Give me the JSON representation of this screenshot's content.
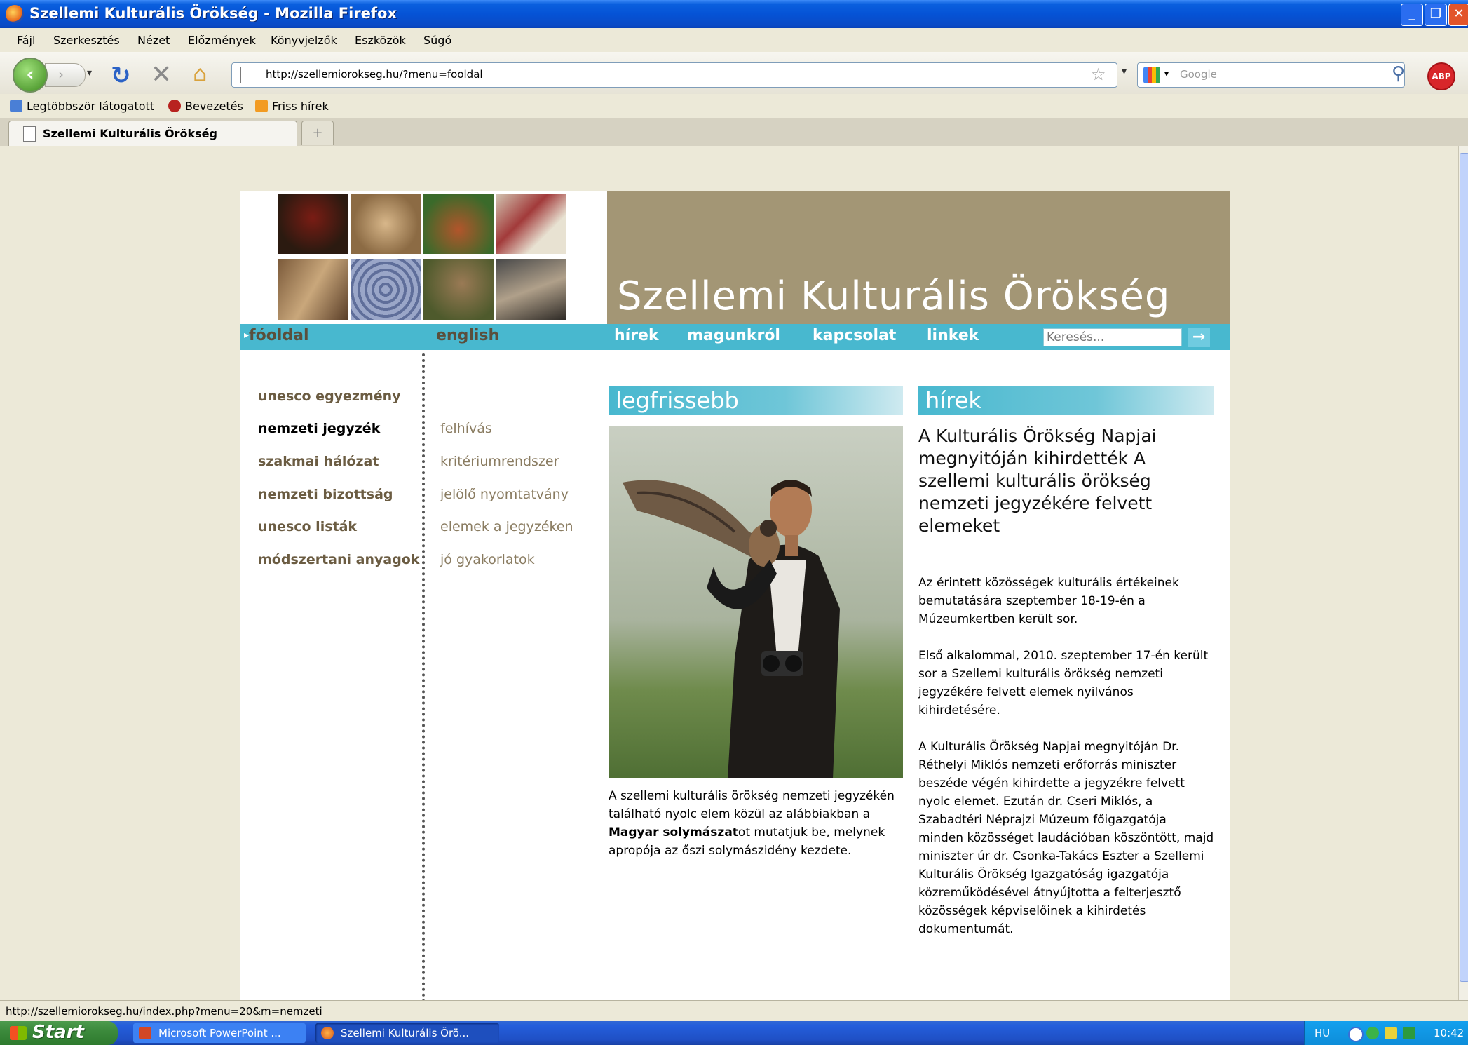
{
  "window": {
    "title": "Szellemi Kulturális Örökség - Mozilla Firefox"
  },
  "menubar": {
    "items": [
      "Fájl",
      "Szerkesztés",
      "Nézet",
      "Előzmények",
      "Könyvjelzők",
      "Eszközök",
      "Súgó"
    ]
  },
  "navbar": {
    "url": "http://szellemiorokseg.hu/?menu=fooldal",
    "search_placeholder": "Google",
    "abp_label": "ABP"
  },
  "bookmarks": {
    "items": [
      "Legtöbbször látogatott",
      "Bevezetés",
      "Friss hírek"
    ]
  },
  "tabs": {
    "active_label": "Szellemi Kulturális Örökség",
    "new_tab": "+"
  },
  "site": {
    "title": "Szellemi Kulturális Örökség",
    "nav": {
      "fooldal": "fóoldal",
      "english": "english",
      "hirek": "hírek",
      "magunkrol": "magunkról",
      "kapcsolat": "kapcsolat",
      "linkek": "linkek",
      "search_placeholder": "Keresés...",
      "search_button": "→"
    },
    "menu_primary": [
      "unesco egyezmény",
      "nemzeti jegyzék",
      "szakmai hálózat",
      "nemzeti bizottság",
      "unesco listák",
      "módszertani anyagok"
    ],
    "menu_secondary": [
      "felhívás",
      "kritériumrendszer",
      "jelölő nyomtatvány",
      "elemek a jegyzéken",
      "jó gyakorlatok"
    ],
    "latest": {
      "heading": "legfrissebb",
      "caption_a": "A szellemi kulturális örökség nemzeti jegyzékén található nyolc elem közül az alábbiakban a ",
      "caption_bold": "Magyar solymászat",
      "caption_b": "ot mutatjuk be, melynek apropója az őszi solymászidény kezdete."
    },
    "news": {
      "heading": "hírek",
      "title": "A Kulturális Örökség Napjai megnyitóján kihirdették A szellemi kulturális örökség nemzeti jegyzékére felvett elemeket",
      "p1": "Az érintett közösségek kulturális értékeinek bemutatására szeptember 18-19-én a Múzeumkertben került sor.",
      "p2": "Első alkalommal, 2010. szeptember 17-én került sor a Szellemi kulturális örökség nemzeti jegyzékére felvett elemek nyilvános kihirdetésére.",
      "p3": "A Kulturális Örökség Napjai megnyitóján Dr. Réthelyi Miklós nemzeti erőforrás miniszter beszéde végén kihirdette a jegyzékre felvett nyolc elemet. Ezután dr. Cseri Miklós, a Szabadtéri Néprajzi Múzeum főigazgatója minden közösséget laudációban köszöntött, majd miniszter úr dr. Csonka-Takács Eszter a Szellemi Kulturális Örökség Igazgatóság igazgatója közreműködésével átnyújtotta a felterjesztő közösségek képviselőinek a kihirdetés dokumentumát."
    }
  },
  "statusbar": {
    "text": "http://szellemiorokseg.hu/index.php?menu=20&m=nemzeti"
  },
  "taskbar": {
    "start": "Start",
    "items": [
      "Microsoft PowerPoint ...",
      "Szellemi Kulturális Örö..."
    ],
    "lang": "HU",
    "clock": "10:42"
  },
  "colors": {
    "banner": "#a39675",
    "nav_strip": "#48b8cf",
    "menu_text": "#6b5c42"
  }
}
